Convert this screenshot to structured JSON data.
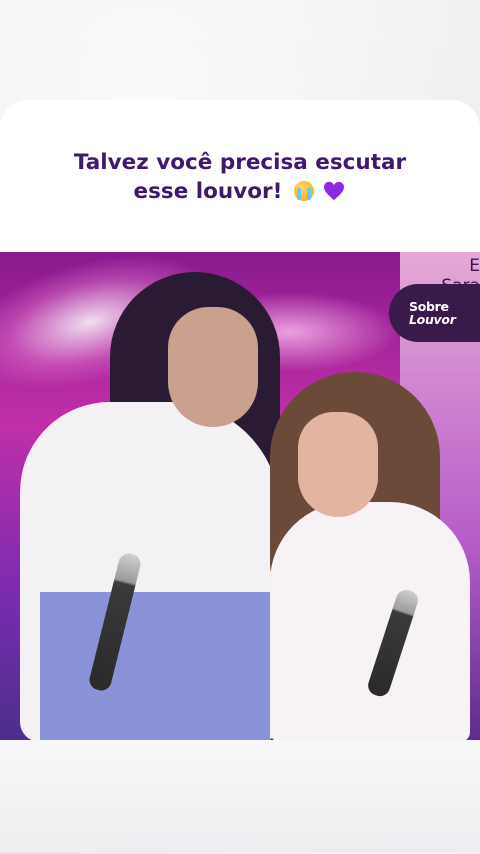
{
  "post": {
    "headline_line1": "Talvez você precisa escutar",
    "headline_line2": "esse louvor!",
    "emojis": [
      "loudly-crying-face",
      "purple-heart"
    ]
  },
  "logo": {
    "line1": "Sobre",
    "line2": "Louvor"
  },
  "background_sign": {
    "line1": "E",
    "line2": "Sara"
  },
  "colors": {
    "headline": "#40186e",
    "logo_badge": "#3a1a4a",
    "heart": "#8a2be2"
  }
}
